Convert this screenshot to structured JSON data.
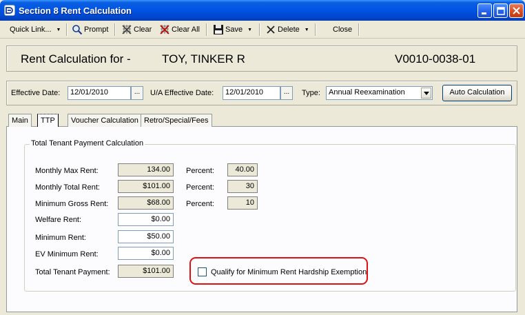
{
  "window": {
    "title": "Section 8 Rent Calculation"
  },
  "toolbar": {
    "quick_link": "Quick Link...",
    "prompt": "Prompt",
    "clear": "Clear",
    "clear_all": "Clear All",
    "save": "Save",
    "delete": "Delete",
    "close": "Close"
  },
  "header": {
    "label": "Rent Calculation for -",
    "tenant_name": "TOY, TINKER R",
    "tenant_id": "V0010-0038-01"
  },
  "dates": {
    "effective_label": "Effective Date:",
    "effective_value": "12/01/2010",
    "ua_effective_label": "U/A Effective Date:",
    "ua_effective_value": "12/01/2010",
    "type_label": "Type:",
    "type_value": "Annual Reexamination",
    "auto_calc": "Auto Calculation",
    "ellipsis": "..."
  },
  "tabs": [
    {
      "label": "Main"
    },
    {
      "label": "TTP"
    },
    {
      "label": "Voucher Calculation"
    },
    {
      "label": "Retro/Special/Fees"
    }
  ],
  "ttp": {
    "group_title": "Total Tenant Payment Calculation",
    "monthly_max_rent_label": "Monthly Max Rent:",
    "monthly_max_rent_value": "134.00",
    "monthly_total_rent_label": "Monthly Total Rent:",
    "monthly_total_rent_value": "$101.00",
    "minimum_gross_rent_label": "Minimum Gross Rent:",
    "minimum_gross_rent_value": "$68.00",
    "welfare_rent_label": "Welfare Rent:",
    "welfare_rent_value": "$0.00",
    "minimum_rent_label": "Minimum Rent:",
    "minimum_rent_value": "$50.00",
    "ev_minimum_rent_label": "EV Minimum Rent:",
    "ev_minimum_rent_value": "$0.00",
    "total_tenant_payment_label": "Total Tenant Payment:",
    "total_tenant_payment_value": "$101.00",
    "percent_label": "Percent:",
    "percent_1": "40.00",
    "percent_2": "30",
    "percent_3": "10",
    "hardship_label": "Qualify for Minimum Rent Hardship Exemption"
  },
  "colors": {
    "titlebar": "#0055e5",
    "highlight": "#e01010"
  }
}
